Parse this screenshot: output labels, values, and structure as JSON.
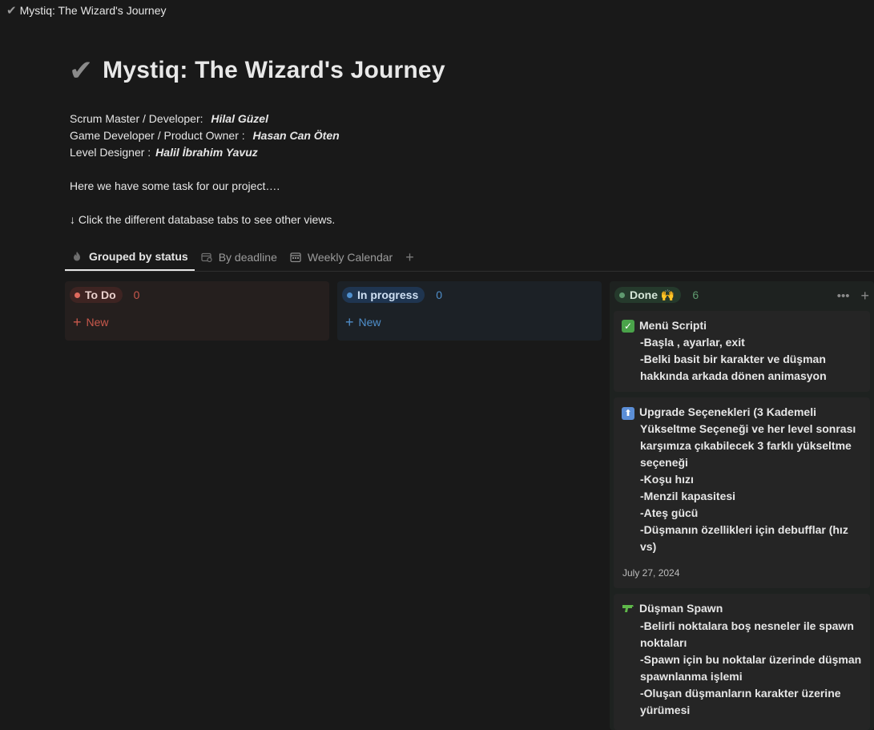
{
  "window": {
    "title": "Mystiq: The Wizard's Journey"
  },
  "page": {
    "title": "Mystiq: The Wizard's Journey",
    "team": [
      {
        "role": "Scrum Master / Developer: ",
        "name": "Hilal Güzel"
      },
      {
        "role": "Game Developer / Product Owner : ",
        "name": "Hasan Can Öten"
      },
      {
        "role": "Level Designer :",
        "name": "Halil İbrahim Yavuz"
      }
    ],
    "intro": "Here we have some task for our project….",
    "hint": "↓ Click the different database tabs to see other views."
  },
  "tabs": [
    {
      "label": "Grouped by status",
      "icon": "fire-icon",
      "active": true
    },
    {
      "label": "By deadline",
      "icon": "calendar-clock-icon",
      "active": false
    },
    {
      "label": "Weekly Calendar",
      "icon": "calendar-icon",
      "active": false
    }
  ],
  "board": {
    "todo": {
      "label": "To Do",
      "count": "0",
      "new_label": "New",
      "color": "#e06a5d"
    },
    "in_progress": {
      "label": "In progress",
      "count": "0",
      "new_label": "New",
      "color": "#4f90cf"
    },
    "done": {
      "label": "Done 🙌",
      "count": "6",
      "color": "#5f9a6f",
      "cards": [
        {
          "icon": "check-box-icon",
          "title": "Menü Scripti",
          "lines": [
            "-Başla , ayarlar, exit",
            "-Belki basit bir karakter ve düşman",
            "hakkında arkada dönen animasyon"
          ],
          "date": ""
        },
        {
          "icon": "up-arrow-box-icon",
          "title": "Upgrade Seçenekleri (3 Kademeli",
          "lines": [
            "Yükseltme Seçeneği ve her level sonrası",
            "karşımıza çıkabilecek 3 farklı yükseltme",
            "seçeneği",
            "-Koşu hızı",
            "-Menzil kapasitesi",
            "-Ateş gücü",
            "-Düşmanın özellikleri için debufflar (hız",
            "vs)"
          ],
          "date": "July 27, 2024"
        },
        {
          "icon": "water-pistol-icon",
          "title": "Düşman Spawn",
          "lines": [
            "-Belirli noktalara boş nesneler ile spawn",
            "noktaları",
            "-Spawn için bu noktalar üzerinde düşman",
            "spawnlanma işlemi",
            "-Oluşan düşmanların karakter üzerine",
            "yürümesi"
          ],
          "date": ""
        }
      ]
    }
  }
}
